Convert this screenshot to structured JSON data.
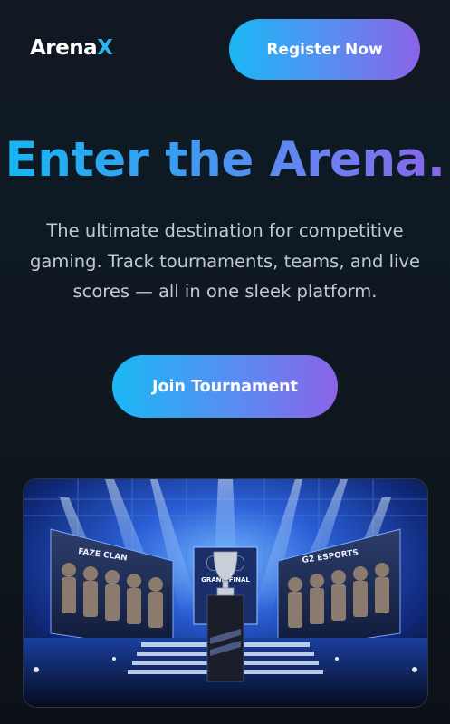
{
  "header": {
    "logo_main": "Arena",
    "logo_accent": "X",
    "register_label": "Register Now"
  },
  "hero": {
    "title": "Enter the Arena.",
    "subtitle": "The ultimate destination for competitive gaming. Track tournaments, teams, and live scores — all in one sleek platform.",
    "join_label": "Join Tournament"
  },
  "image": {
    "left_screen_text": "FAZE CLAN",
    "center_screen_text": "GRAND FINAL",
    "right_screen_text": "G2 ESPORTS"
  },
  "colors": {
    "accent_start": "#1ab8f5",
    "accent_end": "#8b63e8",
    "background": "#0c1117"
  }
}
